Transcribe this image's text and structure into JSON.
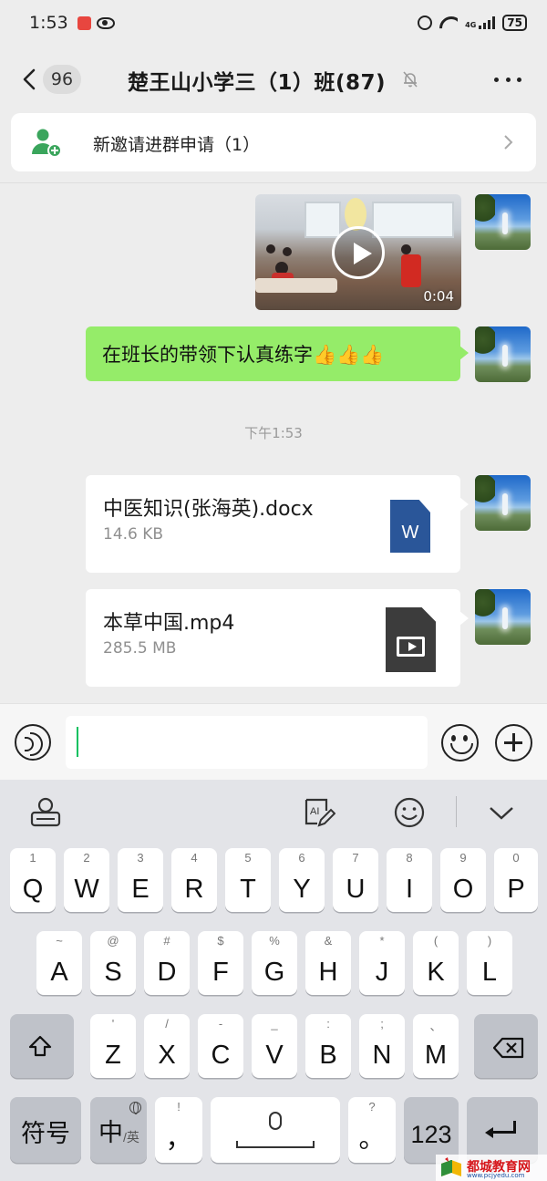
{
  "status_bar": {
    "time": "1:53",
    "battery": "75",
    "network": "4G"
  },
  "header": {
    "unread_count": "96",
    "title": "楚王山小学三（1）班(87)"
  },
  "invite_banner": {
    "label": "新邀请进群申请（1）"
  },
  "messages": {
    "video": {
      "duration": "0:04"
    },
    "text": {
      "content": "在班长的带领下认真练字👍👍👍"
    },
    "timestamp": "下午1:53",
    "files": [
      {
        "name": "中医知识(张海英).docx",
        "size": "14.6 KB",
        "type_icon": "word-doc-icon",
        "icon_letter": "W"
      },
      {
        "name": "本草中国.mp4",
        "size": "285.5 MB",
        "type_icon": "video-file-icon"
      }
    ]
  },
  "input_bar": {
    "value": ""
  },
  "keyboard": {
    "row1": [
      {
        "main": "Q",
        "hint": "1"
      },
      {
        "main": "W",
        "hint": "2"
      },
      {
        "main": "E",
        "hint": "3"
      },
      {
        "main": "R",
        "hint": "4"
      },
      {
        "main": "T",
        "hint": "5"
      },
      {
        "main": "Y",
        "hint": "6"
      },
      {
        "main": "U",
        "hint": "7"
      },
      {
        "main": "I",
        "hint": "8"
      },
      {
        "main": "O",
        "hint": "9"
      },
      {
        "main": "P",
        "hint": "0"
      }
    ],
    "row2": [
      {
        "main": "A",
        "hint": "~"
      },
      {
        "main": "S",
        "hint": "@"
      },
      {
        "main": "D",
        "hint": "#"
      },
      {
        "main": "F",
        "hint": "$"
      },
      {
        "main": "G",
        "hint": "%"
      },
      {
        "main": "H",
        "hint": "&"
      },
      {
        "main": "J",
        "hint": "*"
      },
      {
        "main": "K",
        "hint": "("
      },
      {
        "main": "L",
        "hint": ")"
      }
    ],
    "row3": [
      {
        "main": "Z",
        "hint": "'"
      },
      {
        "main": "X",
        "hint": "/"
      },
      {
        "main": "C",
        "hint": "-"
      },
      {
        "main": "V",
        "hint": "_"
      },
      {
        "main": "B",
        "hint": ":"
      },
      {
        "main": "N",
        "hint": ";"
      },
      {
        "main": "M",
        "hint": "、"
      }
    ],
    "symbols_label": "符号",
    "lang_label": "中",
    "lang_alt": "/英",
    "comma_hint": "!",
    "comma_label": "，",
    "period_hint": "?",
    "period_label": "。",
    "numbers_label": "123",
    "ai_label": "AI"
  },
  "watermark": {
    "title": "都城教育网",
    "url": "www.pcjyedu.com"
  },
  "colors": {
    "bubble_green": "#95ec69",
    "accent_green": "#07c160",
    "word_blue": "#2a5699",
    "chat_bg": "#ededed",
    "keyboard_bg": "#e3e4e8"
  }
}
